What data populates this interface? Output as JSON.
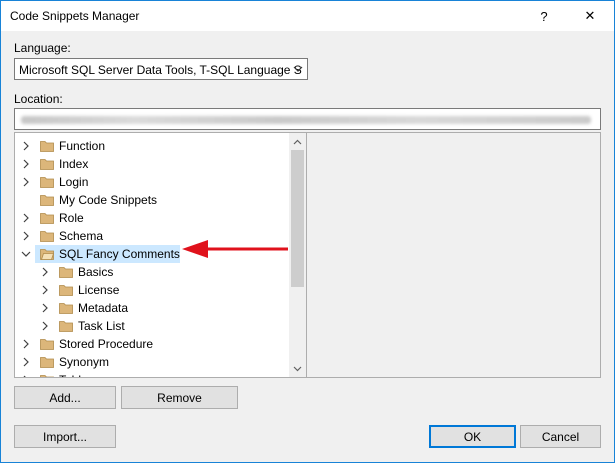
{
  "window": {
    "title": "Code Snippets Manager",
    "help_glyph": "?",
    "close_glyph": "✕"
  },
  "language": {
    "label": "Language:",
    "selected": "Microsoft SQL Server Data Tools, T-SQL Language S"
  },
  "location": {
    "label": "Location:"
  },
  "tree": {
    "items": [
      {
        "label": "Function",
        "expanded": false,
        "level": 0
      },
      {
        "label": "Index",
        "expanded": false,
        "level": 0
      },
      {
        "label": "Login",
        "expanded": false,
        "level": 0
      },
      {
        "label": "My Code Snippets",
        "expanded": null,
        "level": 0
      },
      {
        "label": "Role",
        "expanded": false,
        "level": 0
      },
      {
        "label": "Schema",
        "expanded": false,
        "level": 0
      },
      {
        "label": "SQL Fancy Comments",
        "expanded": true,
        "level": 0,
        "selected": true
      },
      {
        "label": "Basics",
        "expanded": false,
        "level": 1
      },
      {
        "label": "License",
        "expanded": false,
        "level": 1
      },
      {
        "label": "Metadata",
        "expanded": false,
        "level": 1
      },
      {
        "label": "Task List",
        "expanded": false,
        "level": 1
      },
      {
        "label": "Stored Procedure",
        "expanded": false,
        "level": 0
      },
      {
        "label": "Synonym",
        "expanded": false,
        "level": 0
      },
      {
        "label": "Table",
        "expanded": false,
        "level": 0
      }
    ]
  },
  "buttons": {
    "add": "Add...",
    "remove": "Remove",
    "import": "Import...",
    "ok": "OK",
    "cancel": "Cancel"
  },
  "colors": {
    "selection": "#cce8ff",
    "accent": "#0078d7",
    "annotation_arrow": "#e0121c",
    "folder": "#dcb67a"
  }
}
